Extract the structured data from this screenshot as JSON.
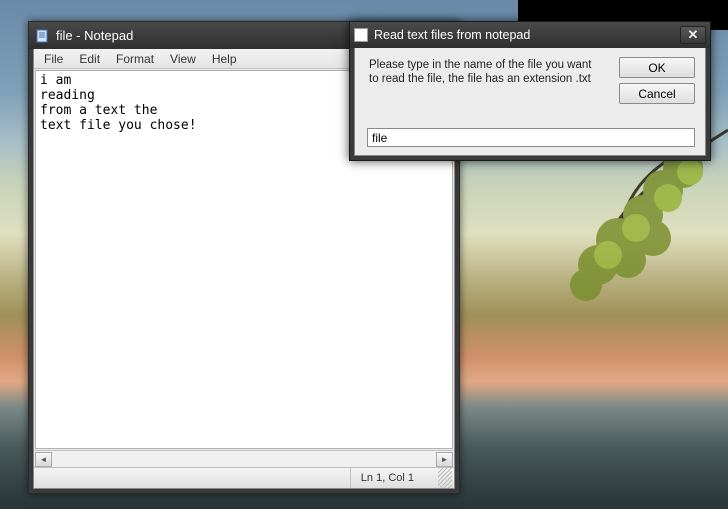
{
  "notepad": {
    "title": "file - Notepad",
    "menu": [
      "File",
      "Edit",
      "Format",
      "View",
      "Help"
    ],
    "content": "i am\nreading\nfrom a text the\ntext file you chose!",
    "status": "Ln 1, Col 1"
  },
  "dialog": {
    "title": "Read text files from notepad",
    "message": "Please type in the name of the file you want to read the file, the file has an extension .txt",
    "ok": "OK",
    "cancel": "Cancel",
    "input_value": "file"
  }
}
